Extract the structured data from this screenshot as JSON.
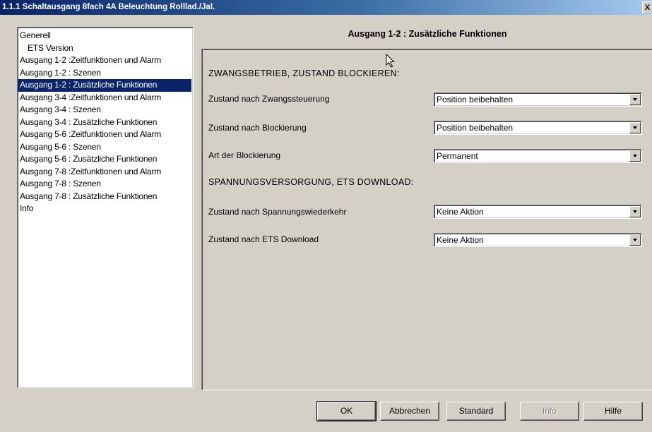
{
  "window": {
    "title": "1.1.1 Schaltausgang 8fach 4A Beleuchtung Rolllad./Jal.",
    "close_label": "X"
  },
  "nav": {
    "items": [
      {
        "label": "Generell",
        "indent": false,
        "selected": false
      },
      {
        "label": "ETS Version",
        "indent": true,
        "selected": false
      },
      {
        "label": "Ausgang 1-2 :Zeitfunktionen und Alarm",
        "indent": false,
        "selected": false
      },
      {
        "label": "Ausgang 1-2 : Szenen",
        "indent": false,
        "selected": false
      },
      {
        "label": "Ausgang 1-2 : Zusätzliche Funktionen",
        "indent": false,
        "selected": true
      },
      {
        "label": "Ausgang 3-4 :Zeitfunktionen und Alarm",
        "indent": false,
        "selected": false
      },
      {
        "label": "Ausgang 3-4 : Szenen",
        "indent": false,
        "selected": false
      },
      {
        "label": "Ausgang 3-4 : Zusätzliche Funktionen",
        "indent": false,
        "selected": false
      },
      {
        "label": "Ausgang 5-6 :Zeitfunktionen und Alarm",
        "indent": false,
        "selected": false
      },
      {
        "label": "Ausgang 5-6 : Szenen",
        "indent": false,
        "selected": false
      },
      {
        "label": "Ausgang 5-6 : Zusätzliche Funktionen",
        "indent": false,
        "selected": false
      },
      {
        "label": "Ausgang 7-8 :Zeitfunktionen und Alarm",
        "indent": false,
        "selected": false
      },
      {
        "label": "Ausgang 7-8 : Szenen",
        "indent": false,
        "selected": false
      },
      {
        "label": "Ausgang 7-8 : Zusätzliche Funktionen",
        "indent": false,
        "selected": false
      },
      {
        "label": "Info",
        "indent": false,
        "selected": false
      }
    ]
  },
  "page": {
    "heading": "Ausgang 1-2 : Zusätzliche Funktionen",
    "section1": "ZWANGSBETRIEB, ZUSTAND BLOCKIEREN:",
    "section2": "SPANNUNGSVERSORGUNG, ETS DOWNLOAD:",
    "params": [
      {
        "label": "Zustand nach Zwangssteuerung",
        "value": "Position beibehalten"
      },
      {
        "label": "Zustand nach Blockierung",
        "value": "Position beibehalten"
      },
      {
        "label": "Art der Blockierung",
        "value": "Permanent"
      },
      {
        "label": "Zustand nach Spannungswiederkehr",
        "value": "Keine Aktion"
      },
      {
        "label": "Zustand nach ETS Download",
        "value": "Keine Aktion"
      }
    ]
  },
  "buttons": {
    "ok": "OK",
    "cancel": "Abbrechen",
    "standard": "Standard",
    "info": "Info",
    "help": "Hilfe"
  },
  "colors": {
    "selection": "#0a246a",
    "dialog_face": "#d4d0c8"
  }
}
